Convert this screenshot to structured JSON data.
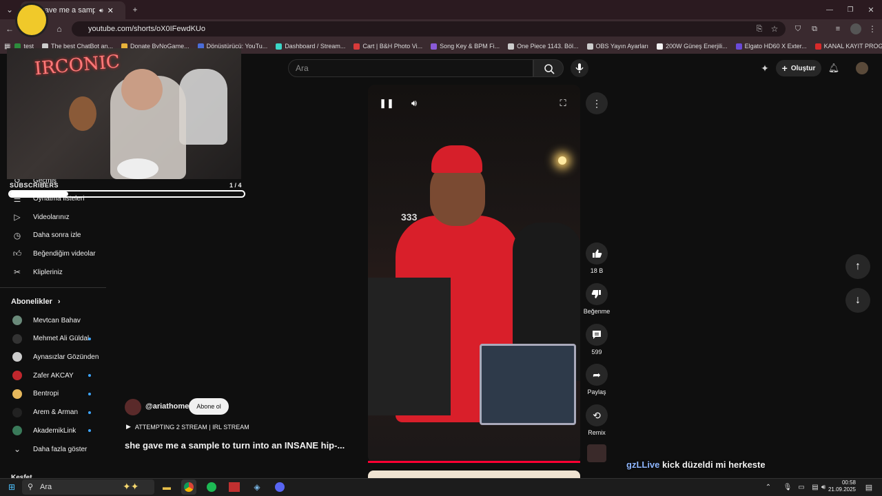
{
  "browser": {
    "tab_title": "she gave me a sample to turn",
    "url": "youtube.com/shorts/oX0IFewdKUo",
    "bookmarks": [
      {
        "label": "test",
        "color": "#2d8c3c"
      },
      {
        "label": "The best ChatBot an...",
        "color": "#cccccc"
      },
      {
        "label": "Donate ByNoGame...",
        "color": "#e8b23a"
      },
      {
        "label": "Dönüştürücü: YouTu...",
        "color": "#4a6cd8"
      },
      {
        "label": "Dashboard / Stream...",
        "color": "#3bd6c6"
      },
      {
        "label": "Cart | B&H Photo Vi...",
        "color": "#d83a3a"
      },
      {
        "label": "Song Key & BPM Fi...",
        "color": "#8a5ad8"
      },
      {
        "label": "One Piece 1143. Böl...",
        "color": "#cccccc"
      },
      {
        "label": "OBS Yayın Ayarları",
        "color": "#cccccc"
      },
      {
        "label": "200W Güneş Enerjili...",
        "color": "#f2f2f2"
      },
      {
        "label": "Elgato HD60 X Exter...",
        "color": "#6a4ad8"
      },
      {
        "label": "KANAL KAYIT PROG...",
        "color": "#d82a2a"
      }
    ]
  },
  "youtube": {
    "search_placeholder": "Ara",
    "create_label": "Oluştur"
  },
  "overlay": {
    "neon_text": "IRCONIC",
    "subs_label": "SUBSCRIBERS",
    "subs_count": "1 / 4",
    "subs_progress": 0.25
  },
  "sidebar": {
    "items": [
      {
        "label": "Geçmiş",
        "icon": "history-icon"
      },
      {
        "label": "Oynatma listeleri",
        "icon": "playlist-icon"
      },
      {
        "label": "Videolarınız",
        "icon": "video-icon"
      },
      {
        "label": "Daha sonra izle",
        "icon": "clock-icon"
      },
      {
        "label": "Beğendiğim videolar",
        "icon": "thumbs-up-icon"
      },
      {
        "label": "Klipleriniz",
        "icon": "scissors-icon"
      }
    ],
    "subs_heading": "Abonelikler",
    "subscriptions": [
      {
        "label": "Mevtcan Bahav",
        "color": "#6a8a7a",
        "new": false
      },
      {
        "label": "Mehmet Ali Güldal",
        "color": "#333333",
        "new": true
      },
      {
        "label": "Aynasızlar Gözünden",
        "color": "#cccccc",
        "new": false
      },
      {
        "label": "Zafer AKCAY",
        "color": "#c0272d",
        "new": true
      },
      {
        "label": "Bentropi",
        "color": "#e6b85c",
        "new": true
      },
      {
        "label": "Arem & Arman",
        "color": "#222222",
        "new": true
      },
      {
        "label": "AkademikLink",
        "color": "#3a7a5a",
        "new": true
      }
    ],
    "more_label": "Daha fazla göster",
    "explore_label": "Keşfet"
  },
  "short": {
    "channel": "@ariathome",
    "subscribe_label": "Abone ol",
    "playlist": "ATTEMPTING 2 STREAM | IRL STREAM",
    "title": "she gave me a sample to turn into an INSANE hip-...",
    "overlay_text": "333",
    "likes": "18 B",
    "dislike_label": "Beğenme",
    "comments": "599",
    "share_label": "Paylaş",
    "remix_label": "Remix"
  },
  "chat": {
    "user": "gzLLive",
    "message": "kick düzeldi mi herkeste"
  },
  "taskbar": {
    "search_placeholder": "Ara",
    "time": "00:58",
    "date": "21.09.2025"
  }
}
